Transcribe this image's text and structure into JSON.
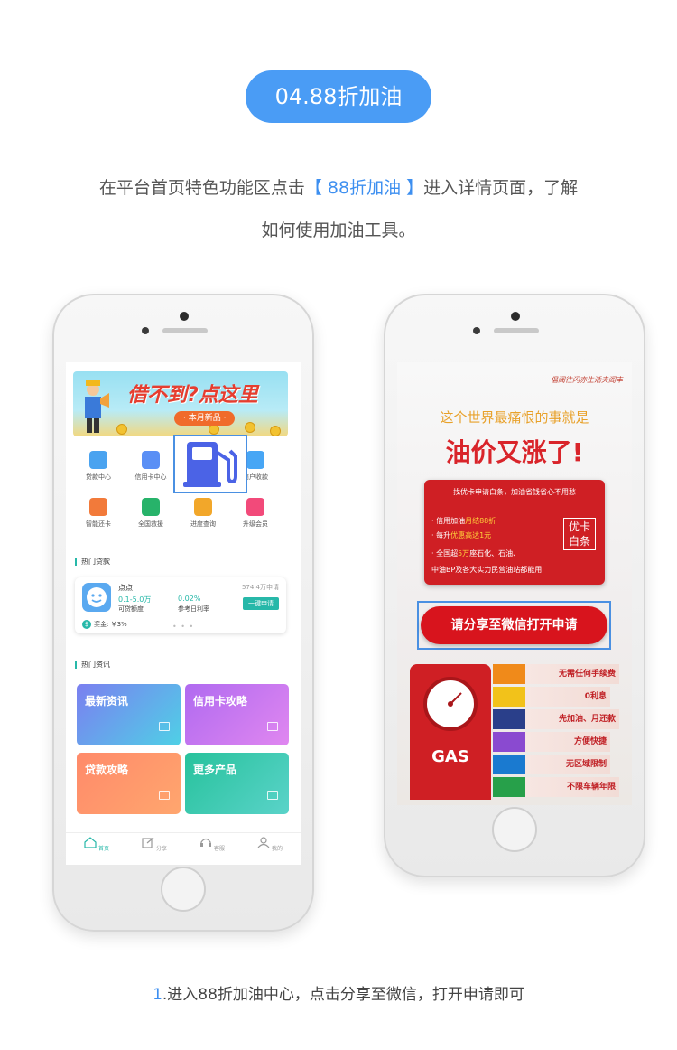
{
  "header": {
    "badge": "04.88折加油",
    "intro_pre": "在平台首页特色功能区点击",
    "intro_highlight": "【 88折加油 】",
    "intro_post": "进入详情页面，了解",
    "intro_line2": "如何使用加油工具。"
  },
  "left_phone": {
    "banner": {
      "title": "借不到?点这里",
      "tag": "· 本月新品 ·"
    },
    "features": [
      {
        "label": "贷款中心",
        "color": "#4aa3f0"
      },
      {
        "label": "信用卡中心",
        "color": "#5a8ff5"
      },
      {
        "label": "",
        "color": "#4b63e6"
      },
      {
        "label": "商户收款",
        "color": "#47a6f5"
      },
      {
        "label": "智能还卡",
        "color": "#f27a3a"
      },
      {
        "label": "全国救援",
        "color": "#27b36a"
      },
      {
        "label": "进度查询",
        "color": "#f2a72a"
      },
      {
        "label": "升级会员",
        "color": "#f24a7a"
      }
    ],
    "hot_loans_title": "热门贷款",
    "loan": {
      "name": "点点",
      "applicants": "574.4万申请",
      "amount": "0.1-5.0万",
      "amount_label": "可贷额度",
      "rate": "0.02%",
      "rate_label": "参考日利率",
      "button": "一键申请",
      "bonus": "奖金: ￥3%",
      "bonus_icon": "$",
      "pager": "• • •"
    },
    "hot_news_title": "热门资讯",
    "news": [
      {
        "label": "最新资讯",
        "from": "#7b7ff0",
        "to": "#4fd0e6"
      },
      {
        "label": "信用卡攻略",
        "from": "#b06af0",
        "to": "#e087f0"
      },
      {
        "label": "贷款攻略",
        "from": "#ff8a6a",
        "to": "#ffa66e"
      },
      {
        "label": "更多产品",
        "from": "#27c29c",
        "to": "#5ad3c9"
      }
    ],
    "tabs": [
      "首页",
      "分享",
      "客服",
      "我的"
    ],
    "accent": "#27b8a9"
  },
  "right_phone": {
    "script_text": "倡阀往闪亦生活夫阎丰",
    "headline1": "这个世界最痛恨的事就是",
    "headline2": "油价又涨了!",
    "box_top": "找优卡申请白条，加油省钱省心不用愁",
    "box_lines": [
      {
        "pre": "· 信用加油",
        "hl": "月结88折",
        "post": ""
      },
      {
        "pre": "· 每升",
        "hl": "优惠高达1元",
        "post": ""
      },
      {
        "pre": "· 全国超",
        "hl": "5万",
        "post": "座石化、石油、"
      },
      {
        "pre": "  中油BP及各大实力民营油站都能用",
        "hl": "",
        "post": ""
      }
    ],
    "badge": "优卡\n白条",
    "cta": "请分享至微信打开申请",
    "gas_label": "GAS",
    "bars": [
      {
        "text": "无需任何手续费",
        "color": "#f08a1a"
      },
      {
        "text": "0利息",
        "color": "#f2c21a"
      },
      {
        "text": "先加油、月还款",
        "color": "#2a3f8a"
      },
      {
        "text": "方便快捷",
        "color": "#8a4ad0"
      },
      {
        "text": "无区域限制",
        "color": "#1a7ad0"
      },
      {
        "text": "不限车辆年限",
        "color": "#27a04a"
      }
    ]
  },
  "caption": {
    "num": "1",
    "text": ".进入88折加油中心，点击分享至微信，打开申请即可"
  }
}
